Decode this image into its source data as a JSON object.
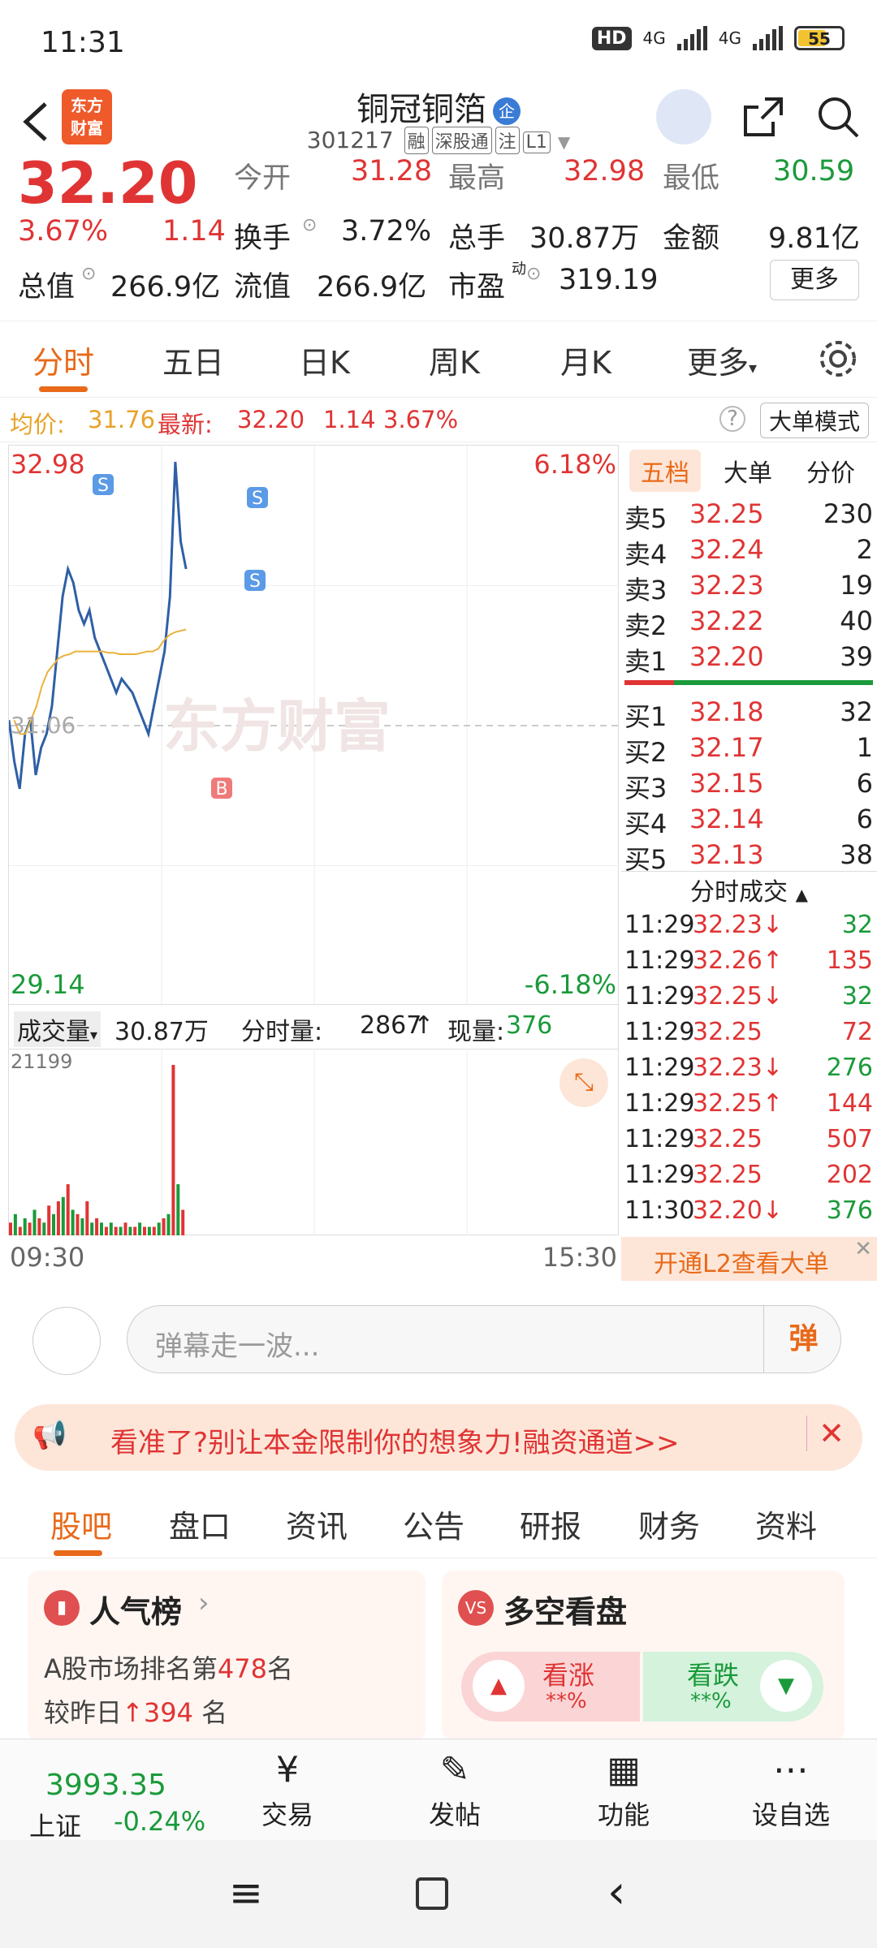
{
  "status": {
    "time": "11:31",
    "hd": "HD",
    "net1": "4G",
    "net2": "4G",
    "battery": "55"
  },
  "header": {
    "logo_line1": "东方",
    "logo_line2": "财富",
    "title": "铜冠铜箔",
    "badge": "企",
    "code": "301217",
    "tags": [
      "融",
      "深股通",
      "注",
      "L1"
    ]
  },
  "quote": {
    "price": "32.20",
    "change_pct": "3.67%",
    "change": "1.14",
    "open_label": "今开",
    "open": "31.28",
    "high_label": "最高",
    "high": "32.98",
    "low_label": "最低",
    "low": "30.59",
    "turnover_label": "换手",
    "turnover": "3.72%",
    "volume_label": "总手",
    "volume": "30.87万",
    "amount_label": "金额",
    "amount": "9.81亿",
    "mcap_label": "总值",
    "mcap": "266.9亿",
    "float_label": "流值",
    "float": "266.9亿",
    "pe_label": "市盈",
    "pe_sup": "动",
    "pe": "319.19",
    "more": "更多"
  },
  "ktabs": {
    "t1": "分时",
    "t2": "五日",
    "t3": "日K",
    "t4": "周K",
    "t5": "月K",
    "t6": "更多"
  },
  "infoline": {
    "avg_label": "均价:",
    "avg": "31.76",
    "latest_label": "最新:",
    "latest": "32.20",
    "chg": "1.14",
    "pct": "3.67%",
    "mode": "大单模式"
  },
  "chart_labels": {
    "max": "32.98",
    "min": "29.14",
    "max_pct": "6.18%",
    "min_pct": "-6.18%",
    "prev": "31.06",
    "watermark": "东方财富",
    "s": "S",
    "b": "B"
  },
  "volume": {
    "label": "成交量",
    "total": "30.87万",
    "period_label": "分时量:",
    "period": "2867",
    "now_label": "现量:",
    "now": "376",
    "max": "21199"
  },
  "times": {
    "start": "09:30",
    "end": "15:30"
  },
  "chart_data": {
    "type": "line",
    "title": "",
    "ylim": [
      29.14,
      32.98
    ],
    "prev_close": 31.06,
    "series": [
      {
        "values": [
          31.1,
          30.8,
          30.6,
          31.0,
          31.1,
          30.7,
          30.9,
          31.0,
          31.2,
          31.6,
          32.0,
          32.2,
          32.1,
          31.9,
          31.8,
          31.9,
          31.7,
          31.6,
          31.5,
          31.4,
          31.3,
          31.4,
          31.35,
          31.3,
          31.2,
          31.1,
          31.0,
          31.2,
          31.4,
          31.6,
          32.0,
          32.98,
          32.4,
          32.2
        ]
      },
      {
        "values": [
          31.1,
          31.0,
          31.0,
          31.1,
          31.2,
          31.35,
          31.45,
          31.5,
          31.55,
          31.57,
          31.58,
          31.6,
          31.6,
          31.6,
          31.6,
          31.6,
          31.6,
          31.59,
          31.59,
          31.58,
          31.58,
          31.58,
          31.58,
          31.59,
          31.6,
          31.6,
          31.62,
          31.68,
          31.72,
          31.74,
          31.75,
          31.76
        ]
      }
    ],
    "volumes": [
      3,
      5,
      2,
      4,
      3,
      6,
      4,
      3,
      7,
      5,
      8,
      9,
      12,
      6,
      5,
      4,
      8,
      3,
      4,
      3,
      2,
      3,
      2,
      2,
      3,
      2,
      2,
      3,
      2,
      2,
      2,
      3,
      4,
      5,
      21199,
      12,
      6
    ]
  },
  "book": {
    "tab1": "五档",
    "tab2": "大单",
    "tab3": "分价",
    "asks": [
      {
        "name": "卖5",
        "price": "32.25",
        "vol": "230"
      },
      {
        "name": "卖4",
        "price": "32.24",
        "vol": "2"
      },
      {
        "name": "卖3",
        "price": "32.23",
        "vol": "19"
      },
      {
        "name": "卖2",
        "price": "32.22",
        "vol": "40"
      },
      {
        "name": "卖1",
        "price": "32.20",
        "vol": "39"
      }
    ],
    "bids": [
      {
        "name": "买1",
        "price": "32.18",
        "vol": "32"
      },
      {
        "name": "买2",
        "price": "32.17",
        "vol": "1"
      },
      {
        "name": "买3",
        "price": "32.15",
        "vol": "6"
      },
      {
        "name": "买4",
        "price": "32.14",
        "vol": "6"
      },
      {
        "name": "买5",
        "price": "32.13",
        "vol": "38"
      }
    ],
    "ticks_title": "分时成交",
    "ticks": [
      {
        "t": "11:29",
        "p": "32.23",
        "d": "↓",
        "v": "32",
        "c": "red",
        "vc": "green"
      },
      {
        "t": "11:29",
        "p": "32.26",
        "d": "↑",
        "v": "135",
        "c": "red",
        "vc": "red"
      },
      {
        "t": "11:29",
        "p": "32.25",
        "d": "↓",
        "v": "32",
        "c": "red",
        "vc": "green"
      },
      {
        "t": "11:29",
        "p": "32.25",
        "d": "",
        "v": "72",
        "c": "red",
        "vc": "red"
      },
      {
        "t": "11:29",
        "p": "32.23",
        "d": "↓",
        "v": "276",
        "c": "red",
        "vc": "green"
      },
      {
        "t": "11:29",
        "p": "32.25",
        "d": "↑",
        "v": "144",
        "c": "red",
        "vc": "red"
      },
      {
        "t": "11:29",
        "p": "32.25",
        "d": "",
        "v": "507",
        "c": "red",
        "vc": "red"
      },
      {
        "t": "11:29",
        "p": "32.25",
        "d": "",
        "v": "202",
        "c": "red",
        "vc": "red"
      },
      {
        "t": "11:30",
        "p": "32.20",
        "d": "↓",
        "v": "376",
        "c": "red",
        "vc": "green"
      }
    ],
    "l2": "开通L2查看大单"
  },
  "danmu": {
    "placeholder": "弹幕走一波...",
    "btn": "弹"
  },
  "banner": {
    "text": "看准了?别让本金限制你的想象力!融资通道>>"
  },
  "stabs": {
    "t1": "股吧",
    "t2": "盘口",
    "t3": "资讯",
    "t4": "公告",
    "t5": "研报",
    "t6": "财务",
    "t7": "资料"
  },
  "cards": {
    "rank_title": "人气榜",
    "rank_line1_a": "A股市场排名第",
    "rank_num": "478",
    "rank_line1_b": "名",
    "rank_line2_a": "较昨日",
    "rank_change": "394",
    "rank_line2_b": "名",
    "bull_title": "多空看盘",
    "bull_up": "看涨",
    "bull_down": "看跌",
    "bull_up_pct": "**%",
    "bull_down_pct": "**%"
  },
  "bottomnav": {
    "index_val": "3993.35",
    "index_name": "上证",
    "index_chg": "-0.24%",
    "trade": "交易",
    "post": "发帖",
    "func": "功能",
    "watch": "设自选"
  },
  "colors": {
    "up": "#e03434",
    "down": "#1a9a3a",
    "accent": "#e86a1a",
    "line": "#2f5fa6",
    "avg": "#e8b23a"
  }
}
